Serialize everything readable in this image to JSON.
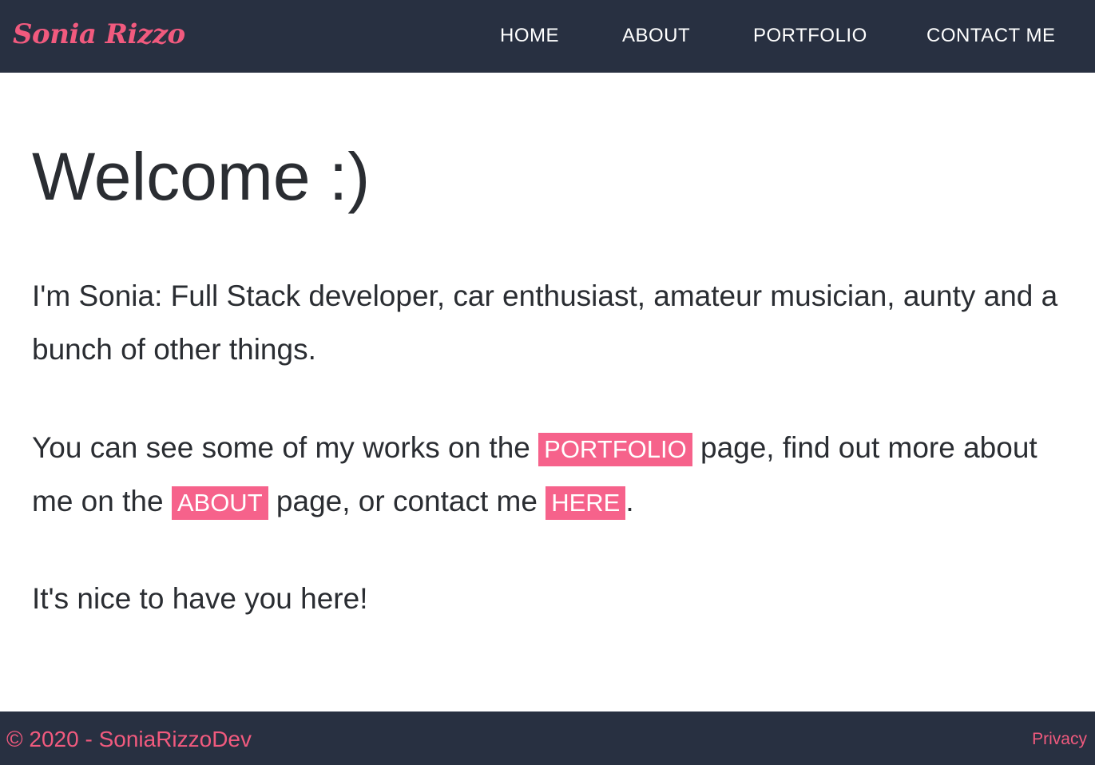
{
  "navbar": {
    "brand": "Sonia Rizzo",
    "links": {
      "home": "HOME",
      "about": "ABOUT",
      "portfolio": "PORTFOLIO",
      "contact": "CONTACT ME"
    }
  },
  "main": {
    "heading": "Welcome :)",
    "intro": "I'm Sonia: Full Stack developer, car enthusiast, amateur musician, aunty and a bunch of other things.",
    "links_paragraph": {
      "part1": "You can see some of my works on the",
      "portfolio_link": "PORTFOLIO",
      "part2": "page, find out more about me on the",
      "about_link": "ABOUT",
      "part3": "page, or contact me",
      "here_link": "HERE",
      "part4": "."
    },
    "closing": "It's nice to have you here!"
  },
  "footer": {
    "copyright": "© 2020 - SoniaRizzoDev",
    "privacy": "Privacy"
  },
  "colors": {
    "navbar_bg": "#283041",
    "accent": "#f6628b",
    "brand_text": "#f15a7e",
    "body_text": "#2a2d32"
  }
}
